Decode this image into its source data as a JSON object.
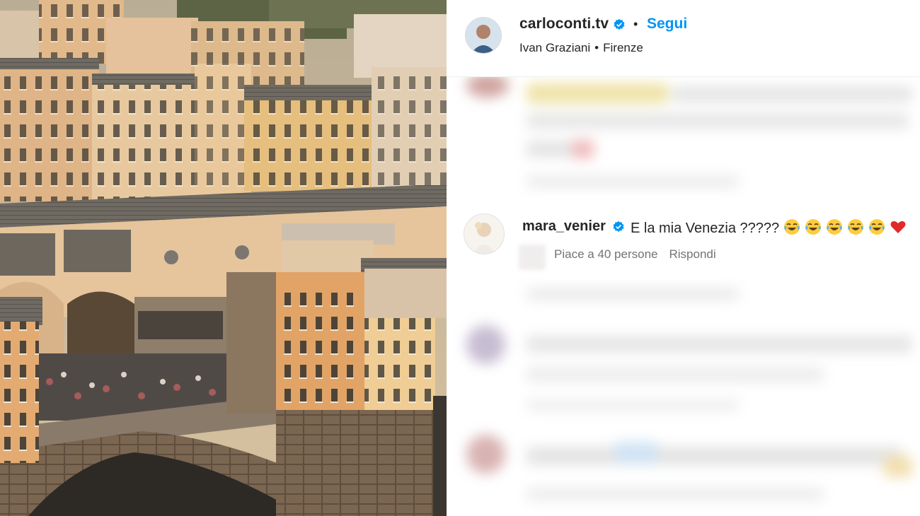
{
  "post": {
    "photo_label": "ponte-vecchio-photo",
    "header": {
      "username": "carloconti.tv",
      "follow_label": "Segui",
      "separator": "•",
      "audio": "Ivan Graziani",
      "location": "Firenze"
    },
    "comment": {
      "username": "mara_venier",
      "text": "E la mia Venezia ?????",
      "emojis": [
        "tears-of-joy-icon",
        "tears-of-joy-icon",
        "tears-of-joy-icon",
        "tears-of-joy-icon",
        "tears-of-joy-icon",
        "red-heart-icon"
      ],
      "likes_text": "Piace a 40 persone",
      "reply_label": "Rispondi"
    }
  },
  "colors": {
    "accent": "#0095f6",
    "text": "#262626",
    "muted": "#737373"
  }
}
